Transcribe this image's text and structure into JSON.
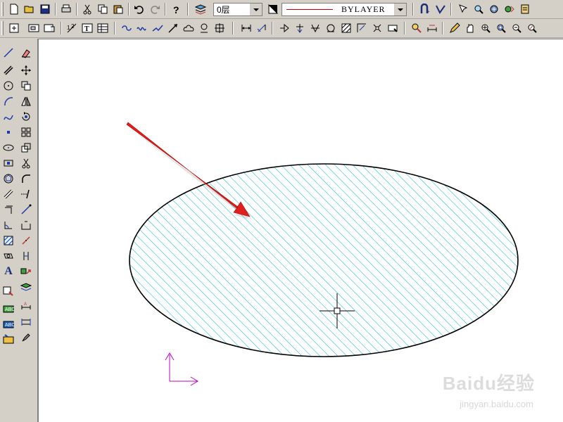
{
  "toolbar": {
    "layer_name": "0层",
    "linetype_label": "BYLAYER",
    "linetype_color": "#c00000"
  },
  "side_toolbar": {
    "text_tool_glyph": "A"
  },
  "canvas": {
    "hatch_color": "#00b7c8",
    "ellipse_stroke": "#000000",
    "arrow_color": "#e0201e",
    "ucs_color": "#c000c0"
  },
  "watermark": {
    "brand": "Baidu经验",
    "url": "jingyan.baidu.com"
  }
}
